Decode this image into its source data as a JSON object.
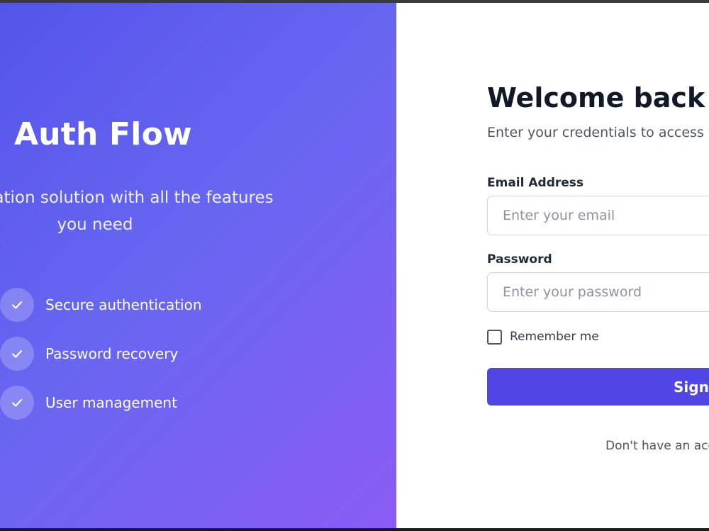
{
  "brand": {
    "title": "Auth Flow",
    "tagline": "authentication solution with all the features you need"
  },
  "features": [
    {
      "label": "Secure authentication",
      "icon": "check-icon"
    },
    {
      "label": "Password recovery",
      "icon": "check-icon"
    },
    {
      "label": "User management",
      "icon": "check-icon"
    }
  ],
  "form": {
    "heading": "Welcome back",
    "subtitle": "Enter your credentials to access yo",
    "email": {
      "label": "Email Address",
      "value": "",
      "placeholder": "Enter your email"
    },
    "password": {
      "label": "Password",
      "value": "",
      "placeholder": "Enter your password"
    },
    "remember": {
      "label": "Remember me",
      "checked": false
    },
    "submit_label": "Sign",
    "signup_prompt": "Don't have an acc"
  },
  "colors": {
    "gradient_start": "#5454ea",
    "gradient_end": "#8a5cf5",
    "button": "#4f46e5",
    "heading": "#111827"
  }
}
